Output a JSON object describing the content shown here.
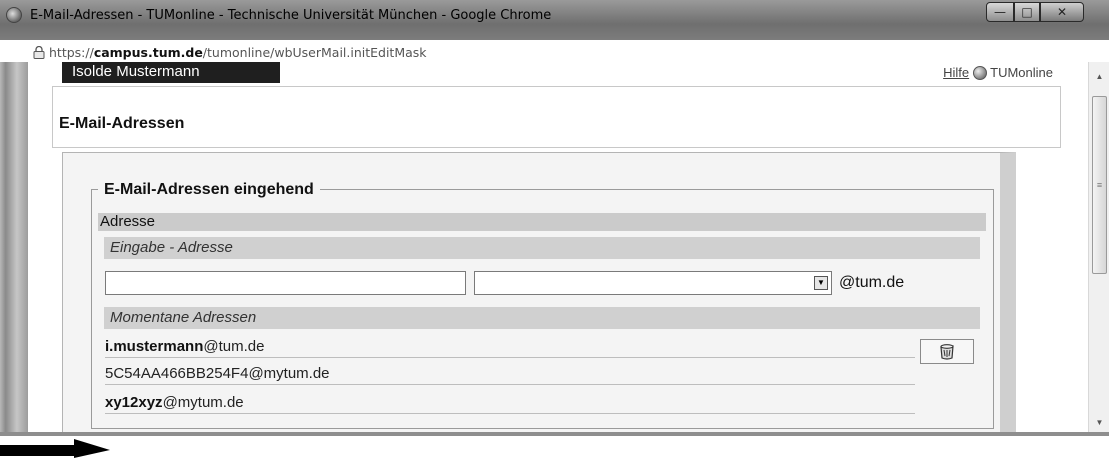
{
  "window": {
    "title": "E-Mail-Adressen - TUMonline - Technische Universität München - Google Chrome",
    "min_glyph": "—",
    "max_glyph": "□",
    "close_glyph": "✕"
  },
  "address_bar": {
    "scheme": "https://",
    "domain": "campus.tum.de",
    "path": "/tumonline/wbUserMail.initEditMask"
  },
  "header": {
    "user_name": "Isolde Mustermann",
    "help_label": "Hilfe",
    "brand": "TUMonline",
    "page_title": "E-Mail-Adressen"
  },
  "form": {
    "legend": "E-Mail-Adressen eingehend",
    "section_label": "Adresse",
    "input_heading": "Eingabe - Adresse",
    "address_value": "",
    "domain_value": "",
    "suffix": "@tum.de",
    "current_heading": "Momentane Adressen",
    "addresses": [
      {
        "user": "i.mustermann",
        "domain": "@tum.de"
      },
      {
        "user": "",
        "domain": "5C54AA466BB254F4@mytum.de"
      },
      {
        "user": "xy12xyz",
        "domain": "@mytum.de"
      }
    ]
  },
  "icons": {
    "page_icon": "globe-icon",
    "lock": "lock-icon",
    "help_logo": "tum-logo-icon",
    "delete": "trash-icon",
    "pointer": "arrow-icon"
  },
  "colors": {
    "user_tab_bg": "#1f1f1f",
    "section_bar_bg": "#cbcbcb",
    "arrow": "#000000"
  }
}
